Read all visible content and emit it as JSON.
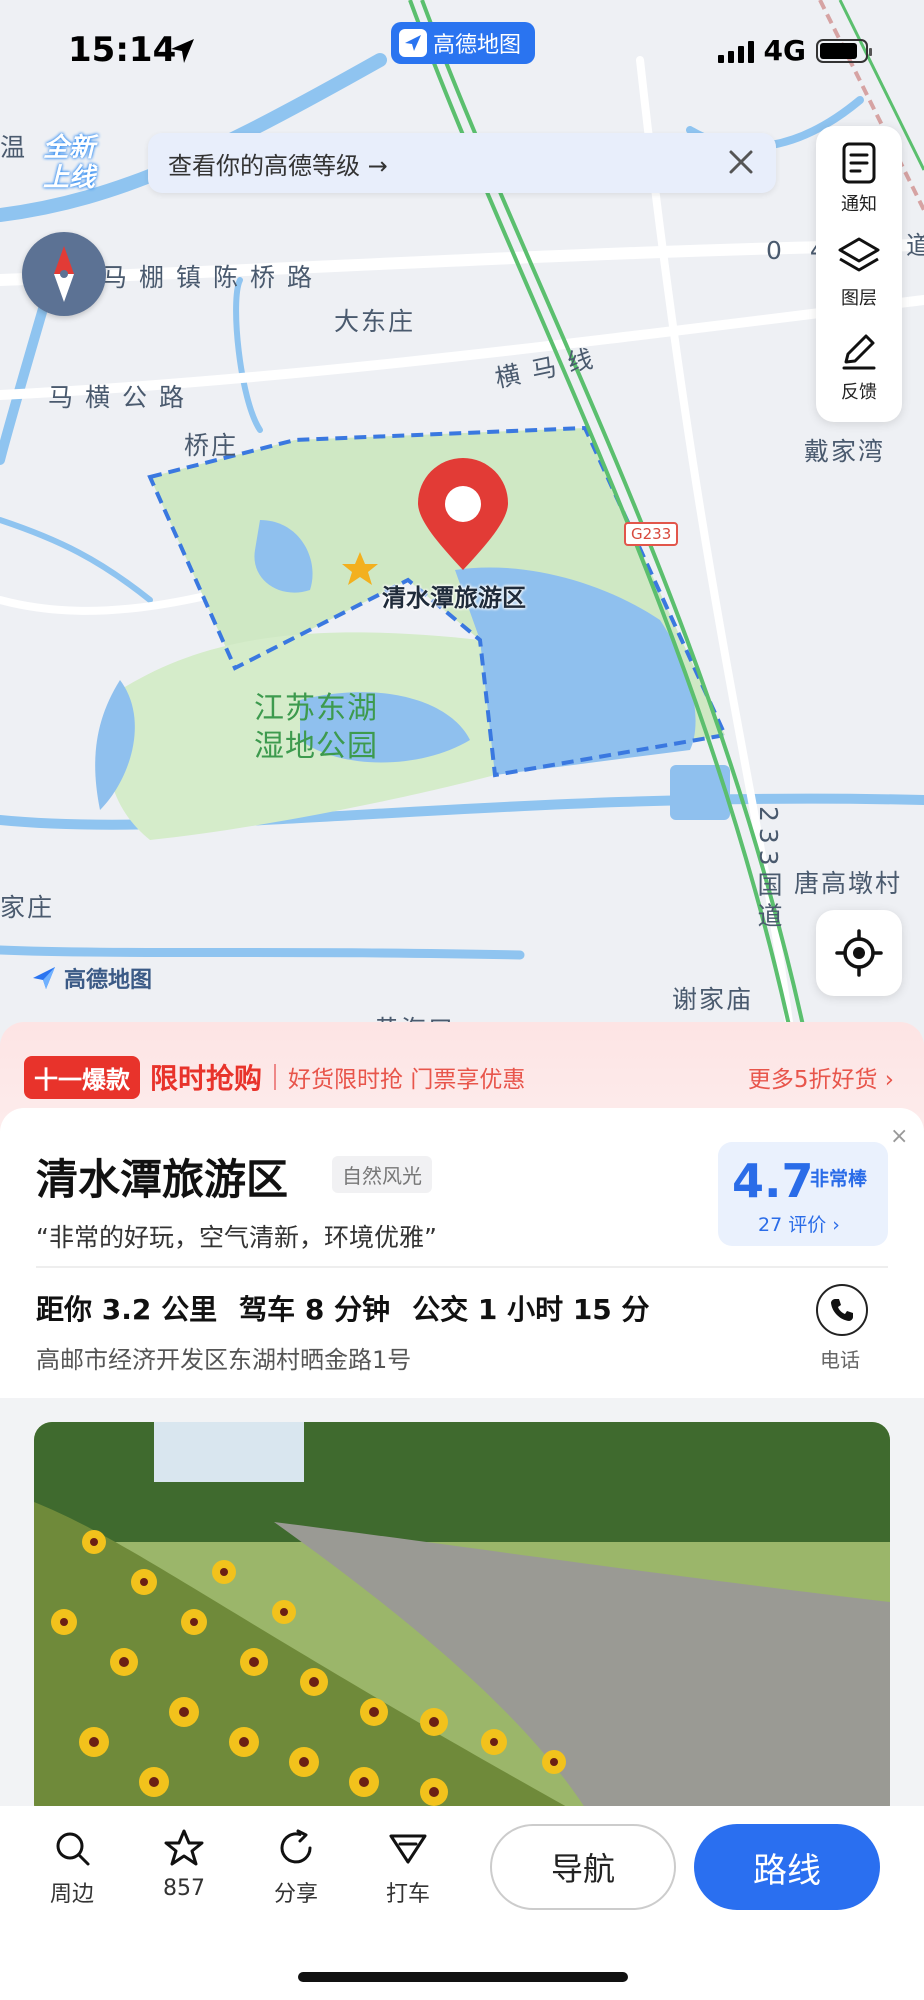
{
  "status": {
    "time": "15:14",
    "network": "4G",
    "battery_level": 0.85
  },
  "brand": {
    "name": "高德地图"
  },
  "map": {
    "new_badge": "全新\n上线",
    "level_banner": "查看你的高德等级 →",
    "tools": [
      {
        "label": "通知",
        "icon": "notice-icon"
      },
      {
        "label": "图层",
        "icon": "layers-icon"
      },
      {
        "label": "反馈",
        "icon": "feedback-icon"
      }
    ],
    "labels": {
      "wen": "温",
      "road1": "马棚镇陈桥路",
      "dadongzhuang": "大东庄",
      "hengmaxian": "横马线",
      "road2": "马横公路",
      "qiaozhuang": "桥庄",
      "daijiawan": "戴家湾",
      "g233": "G233",
      "park": "江苏东湖\n湿地公园",
      "tanggaodun": "唐高墩村",
      "guodao": "233国道",
      "jiazhuang": "家庄",
      "xiejiamiao": "谢家庙",
      "huanghe": "黄海口",
      "num": "0 4",
      "dao": "道"
    },
    "poi_label": "清水潭旅游区",
    "watermark": "高德地图"
  },
  "promo": {
    "tag": "十一爆款",
    "title": "限时抢购",
    "subtitle": "好货限时抢 门票享优惠",
    "more": "更多5折好货 ›"
  },
  "poi": {
    "name": "清水潭旅游区",
    "category": "自然风光",
    "quote": "“非常的好玩，空气清新，环境优雅”",
    "rating": "4.7",
    "rating_word": "非常棒",
    "review_count": "27 评价 ›",
    "distance": "距你 3.2 公里",
    "drive": "驾车 8 分钟",
    "bus": "公交 1 小时 15 分",
    "address": "高邮市经济开发区东湖村晒金路1号",
    "phone_label": "电话",
    "close": "×"
  },
  "bottom": {
    "nearby": "周边",
    "favorites": "857",
    "share": "分享",
    "taxi": "打车",
    "navigate": "导航",
    "route": "路线"
  },
  "colors": {
    "accent": "#2a6ff0",
    "promo_red": "#e8332b",
    "park_green": "#cfe8c4",
    "water": "#8fc0ee"
  }
}
